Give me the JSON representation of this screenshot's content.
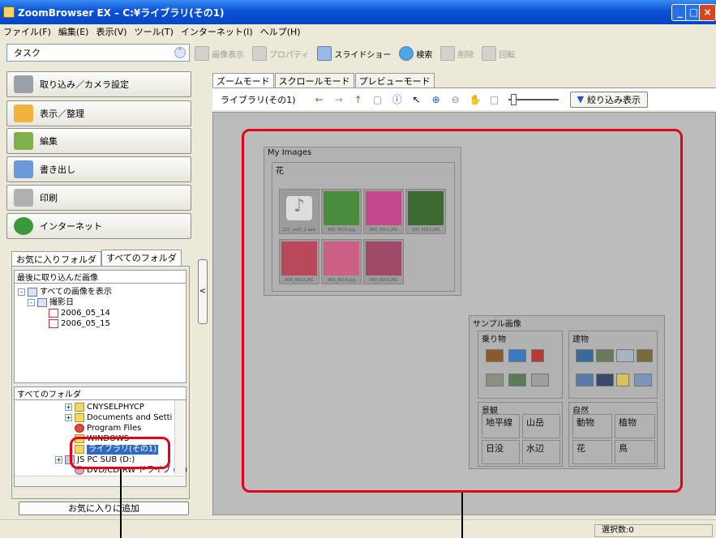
{
  "window": {
    "title": "ZoomBrowser EX  –  C:¥ライブラリ(その1)",
    "controls": [
      "_",
      "□",
      "×"
    ]
  },
  "menu": [
    "ファイル(F)",
    "編集(E)",
    "表示(V)",
    "ツール(T)",
    "インターネット(I)",
    "ヘルプ(H)"
  ],
  "task": {
    "label": "タスク",
    "chevron": "ˆ"
  },
  "toolbar": [
    {
      "label": "画像表示",
      "icon": "image-view-icon",
      "enabled": false
    },
    {
      "label": "プロパティ",
      "icon": "properties-icon",
      "enabled": false
    },
    {
      "label": "スライドショー",
      "icon": "slideshow-icon",
      "enabled": true
    },
    {
      "label": "検索",
      "icon": "search-icon",
      "enabled": true
    },
    {
      "label": "削除",
      "icon": "trash-icon",
      "enabled": false
    },
    {
      "label": "回転",
      "icon": "rotate-icon",
      "enabled": false
    }
  ],
  "sidebar_buttons": [
    {
      "label": "取り込み／カメラ設定",
      "icon": "camera-icon",
      "color": "#9aa0a8"
    },
    {
      "label": "表示／整理",
      "icon": "folder-icon",
      "color": "#f0b43c"
    },
    {
      "label": "編集",
      "icon": "edit-icon",
      "color": "#7fb24a"
    },
    {
      "label": "書き出し",
      "icon": "export-icon",
      "color": "#6a9bd8"
    },
    {
      "label": "印刷",
      "icon": "printer-icon",
      "color": "#b0b0b0"
    },
    {
      "label": "インターネット",
      "icon": "globe-icon",
      "color": "#3a9a3a"
    }
  ],
  "folder_tabs": [
    "お気に入りフォルダ",
    "すべてのフォルダ"
  ],
  "recent": {
    "title": "最後に取り込んだ画像",
    "items": [
      "すべての画像を表示",
      "撮影日",
      "2006_05_14",
      "2006_05_15"
    ]
  },
  "all_folders": {
    "title": "すべてのフォルダ",
    "items": [
      "CNYSELPHYCP",
      "Documents and Setti",
      "Program Files",
      "WINDOWS",
      "ライブラリ(その1)",
      "JS PC SUB (D:)",
      "DVD/CD-RW ドライブ (E:)"
    ]
  },
  "fav_button": "お気に入りに追加",
  "view_tabs": [
    "ズームモード",
    "スクロールモード",
    "プレビューモード"
  ],
  "nav": {
    "location": "ライブラリ(その1)",
    "filter_label": "絞り込み表示",
    "zoom_level": 0.05
  },
  "library": {
    "my_images": "My Images",
    "flower": "花",
    "thumbs": [
      {
        "caption": "221_ss01_1.aaw",
        "kind": "audio",
        "color": "#dddddd"
      },
      {
        "caption": "900_0010.jpg",
        "kind": "photo",
        "color": "#4a8a3c"
      },
      {
        "caption": "900_0011.JPG",
        "kind": "photo",
        "color": "#c24a8a"
      },
      {
        "caption": "900_0012.JPG",
        "kind": "photo",
        "color": "#3c6a32"
      },
      {
        "caption": "900_0013.JPG",
        "kind": "photo",
        "color": "#b8485a"
      },
      {
        "caption": "900_0014.jpg",
        "kind": "photo",
        "color": "#cc5f85"
      },
      {
        "caption": "900_0015.JPG",
        "kind": "photo",
        "color": "#a04a6a"
      }
    ],
    "sample": "サンプル画像",
    "vehicles": "乗り物",
    "buildings": "建物",
    "scenery": "景観",
    "horizon": "地平線",
    "mountain": "山岳",
    "sunset": "日没",
    "waterside": "水辺",
    "nature": "自然",
    "animals": "動物",
    "plants": "植物",
    "flowers": "花",
    "birds": "鳥"
  },
  "status": {
    "selected": "選択数:0"
  },
  "accent": "#e3001b"
}
